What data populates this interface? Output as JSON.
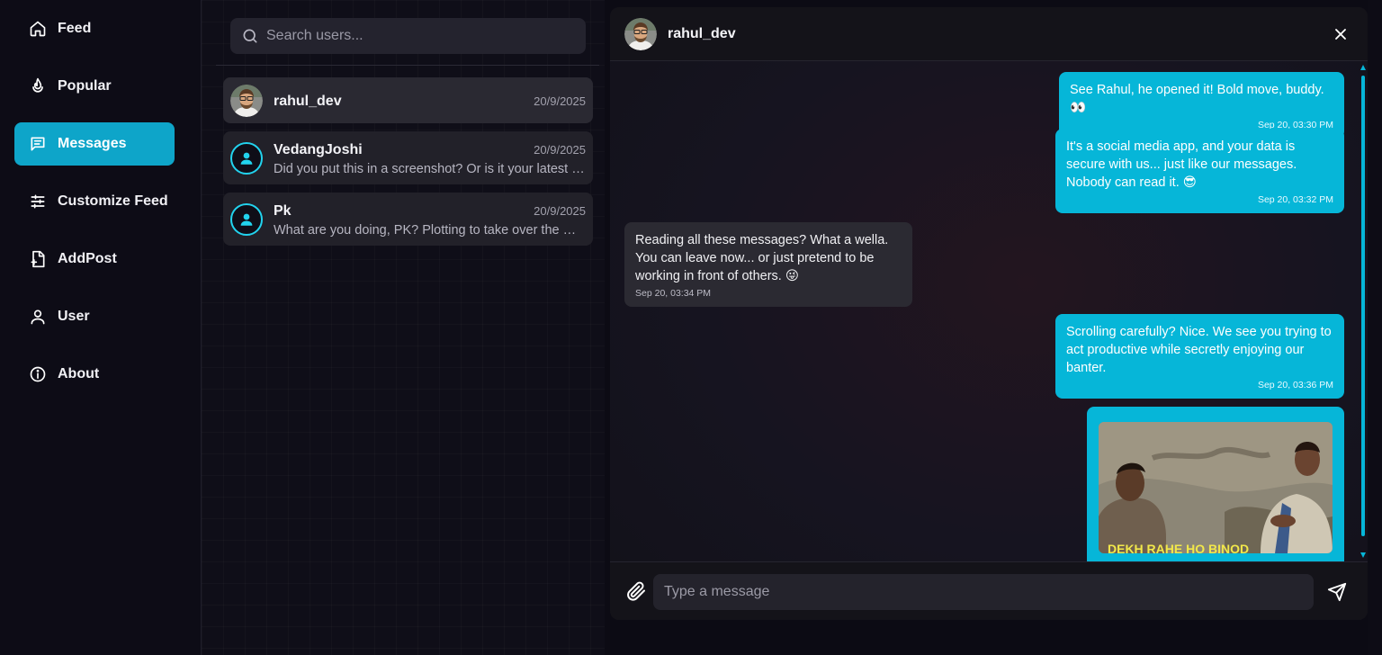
{
  "sidebar": {
    "items": [
      {
        "label": "Feed",
        "icon": "home-icon"
      },
      {
        "label": "Popular",
        "icon": "flame-icon"
      },
      {
        "label": "Messages",
        "icon": "message-square-icon"
      },
      {
        "label": "Customize Feed",
        "icon": "sliders-icon"
      },
      {
        "label": "AddPost",
        "icon": "file-plus-icon"
      },
      {
        "label": "User",
        "icon": "user-icon"
      },
      {
        "label": "About",
        "icon": "info-icon"
      }
    ],
    "active_item": "Messages"
  },
  "search": {
    "placeholder": "Search users...",
    "value": ""
  },
  "conversations": [
    {
      "name": "rahul_dev",
      "date": "20/9/2025",
      "preview": "",
      "avatar": "photo-avatar"
    },
    {
      "name": "VedangJoshi",
      "date": "20/9/2025",
      "preview": "Did you put this in a screenshot? Or is it your latest pic?",
      "avatar": "default-user-avatar"
    },
    {
      "name": "Pk",
      "date": "20/9/2025",
      "preview": "What are you doing, PK? Plotting to take over the world?",
      "avatar": "default-user-avatar"
    }
  ],
  "chat": {
    "name": "rahul_dev",
    "messages": [
      {
        "direction": "out",
        "text": "See Rahul, he opened it! Bold move, buddy. 👀",
        "time": "Sep 20, 03:30 PM"
      },
      {
        "direction": "out",
        "text": "It's a social media app, and your data is secure with us... just like our messages. Nobody can read it. 😎",
        "time": "Sep 20, 03:32 PM"
      },
      {
        "direction": "in",
        "text": "Reading all these messages? What a wella. You can leave now... or just pretend to be working in front of others. 😜",
        "time": "Sep 20, 03:34 PM"
      },
      {
        "direction": "out",
        "text": "Scrolling carefully? Nice. We see you trying to act productive while secretly enjoying our banter.",
        "time": "Sep 20, 03:36 PM"
      },
      {
        "direction": "out",
        "type": "image",
        "caption": "DEKH RAHE HO BINOD"
      }
    ],
    "composer_placeholder": "Type a message",
    "composer_value": ""
  },
  "colors": {
    "accent": "#06b6d8",
    "active_nav": "#0ea5c9",
    "background": "#0c0b14",
    "incoming_bubble": "#2b2a32"
  }
}
